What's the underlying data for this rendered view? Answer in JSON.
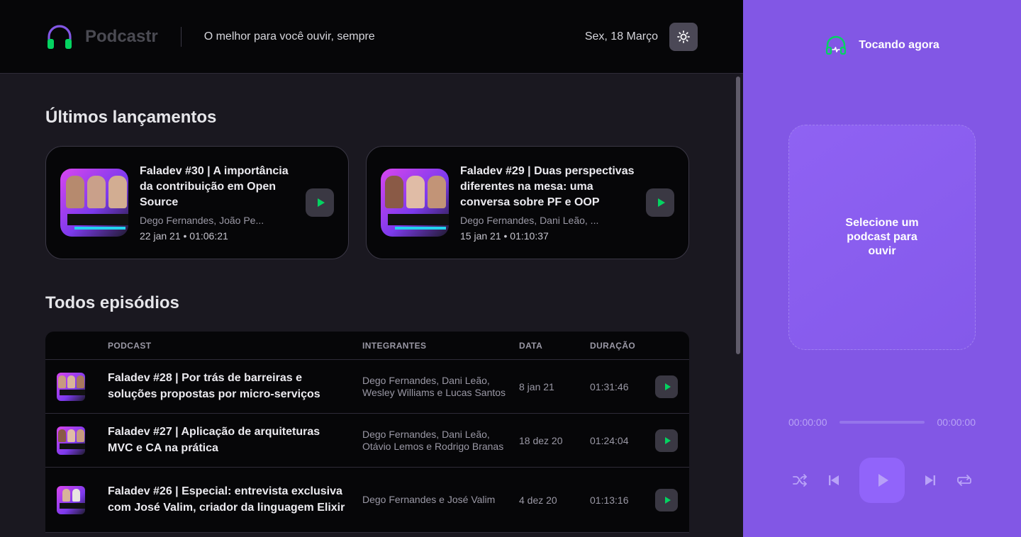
{
  "header": {
    "app_name": "Podcastr",
    "tagline": "O melhor para você ouvir, sempre",
    "date": "Sex, 18 Março"
  },
  "latest": {
    "title": "Últimos lançamentos",
    "episodes": [
      {
        "title": "Faladev #30 | A importância da contribuição em Open Source",
        "members": "Dego Fernandes, João Pe...",
        "meta": "22 jan 21 • 01:06:21"
      },
      {
        "title": "Faladev #29 | Duas perspectivas diferentes na mesa: uma conversa sobre PF e OOP",
        "members": "Dego Fernandes, Dani Leão, ...",
        "meta": "15 jan 21 • 01:10:37"
      }
    ]
  },
  "all": {
    "title": "Todos episódios",
    "headers": {
      "podcast": "PODCAST",
      "members": "INTEGRANTES",
      "date": "DATA",
      "duration": "DURAÇÃO"
    },
    "rows": [
      {
        "title": "Faladev #28 | Por trás de barreiras e soluções propostas por micro-serviços",
        "members": "Dego Fernandes, Dani Leão, Wesley Williams e Lucas Santos",
        "date": "8 jan 21",
        "duration": "01:31:46"
      },
      {
        "title": "Faladev #27 | Aplicação de arquiteturas MVC e CA na prática",
        "members": "Dego Fernandes, Dani Leão, Otávio Lemos e Rodrigo Branas",
        "date": "18 dez 20",
        "duration": "01:24:04"
      },
      {
        "title": "Faladev #26 | Especial: entrevista exclusiva com José Valim, criador da linguagem Elixir",
        "members": "Dego Fernandes e José Valim",
        "date": "4 dez 20",
        "duration": "01:13:16"
      }
    ]
  },
  "player": {
    "now_playing": "Tocando agora",
    "empty_message": "Selecione um podcast para ouvir",
    "current_time": "00:00:00",
    "total_time": "00:00:00",
    "progress": 0
  },
  "colors": {
    "accent": "#8257e5",
    "play_green": "#04d361",
    "background": "#1a1820",
    "surface": "#060608"
  }
}
